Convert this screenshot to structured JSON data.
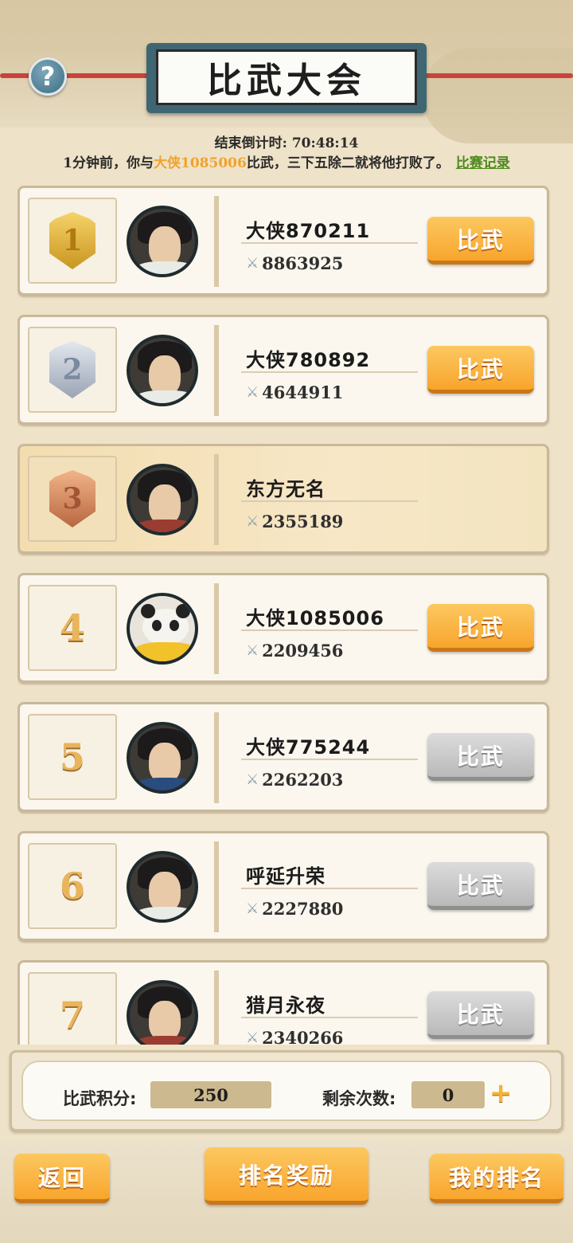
{
  "header": {
    "title": "比武大会",
    "help_icon": "?",
    "countdown_label": "结束倒计时:",
    "countdown_value": "70:48:14",
    "news_prefix": "1分钟前，你与",
    "news_opponent": "大侠1085006",
    "news_suffix": "比武，三下五除二就将他打败了。",
    "records_link": "比赛记录"
  },
  "ranking": [
    {
      "rank": "1",
      "medal": "gold",
      "name": "大侠870211",
      "power": "8863925",
      "button": "比武",
      "button_enabled": true,
      "avatar": "swordsman-white"
    },
    {
      "rank": "2",
      "medal": "silver",
      "name": "大侠780892",
      "power": "4644911",
      "button": "比武",
      "button_enabled": true,
      "avatar": "swordsman-white"
    },
    {
      "rank": "3",
      "medal": "bronze",
      "name": "东方无名",
      "power": "2355189",
      "button": "",
      "button_enabled": false,
      "avatar": "warrior-red",
      "is_self": true
    },
    {
      "rank": "4",
      "medal": "",
      "name": "大侠1085006",
      "power": "2209456",
      "button": "比武",
      "button_enabled": true,
      "avatar": "panda"
    },
    {
      "rank": "5",
      "medal": "",
      "name": "大侠775244",
      "power": "2262203",
      "button": "比武",
      "button_enabled": false,
      "avatar": "lady-blue"
    },
    {
      "rank": "6",
      "medal": "",
      "name": "呼延升荣",
      "power": "2227880",
      "button": "比武",
      "button_enabled": false,
      "avatar": "scholar-white"
    },
    {
      "rank": "7",
      "medal": "",
      "name": "猎月永夜",
      "power": "2340266",
      "button": "比武",
      "button_enabled": false,
      "avatar": "warrior-red"
    }
  ],
  "score": {
    "points_label": "比武积分:",
    "points_value": "250",
    "remaining_label": "剩余次数:",
    "remaining_value": "0",
    "add_icon": "plus-icon"
  },
  "footer": {
    "back": "返回",
    "rewards": "排名奖励",
    "my_rank": "我的排名"
  },
  "colors": {
    "accent_orange": "#f8a52c",
    "highlight_name": "#f2a22a",
    "link_green": "#4e8a1d",
    "disabled_gray": "#b9b9b9"
  }
}
